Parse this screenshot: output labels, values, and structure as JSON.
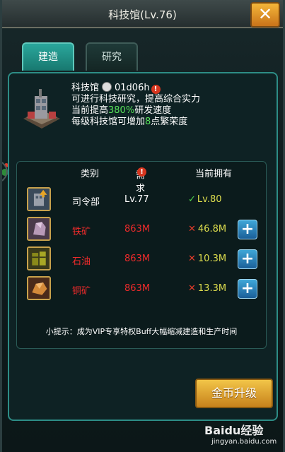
{
  "window": {
    "title": "科技馆(Lv.76)",
    "close_label": "✕"
  },
  "tabs": [
    {
      "label": "建造",
      "active": true
    },
    {
      "label": "研究",
      "active": false
    }
  ],
  "building": {
    "name": "科技馆",
    "timer": "01d06h",
    "line1": "可进行科技研究，提高综合实力",
    "line2_prefix": "当前提高",
    "line2_value": "380%",
    "line2_suffix": "研发速度",
    "line3_prefix": "每级科技馆可增加",
    "line3_value": "8",
    "line3_suffix": "点繁荣度"
  },
  "requirements": {
    "headers": {
      "category": "类别",
      "need": "需求",
      "have": "当前拥有"
    },
    "rows": [
      {
        "category": "司令部",
        "need": "Lv.77",
        "have": "Lv.80",
        "met": true,
        "icon": "hq-icon"
      },
      {
        "category": "铁矿",
        "need": "863M",
        "have": "46.8M",
        "met": false,
        "icon": "iron-ore-icon"
      },
      {
        "category": "石油",
        "need": "863M",
        "have": "10.3M",
        "met": false,
        "icon": "oil-icon"
      },
      {
        "category": "铜矿",
        "need": "863M",
        "have": "13.3M",
        "met": false,
        "icon": "copper-ore-icon"
      }
    ],
    "tip": "小提示：成为VIP专享特权Buff大幅缩减建造和生产时间"
  },
  "upgrade_button": "金币升级",
  "watermark": {
    "brand": "Baidu经验",
    "url": "jingyan.baidu.com"
  },
  "colors": {
    "accent_teal": "#2aa79c",
    "requirement_red": "#ee2b2b",
    "met_yellow": "#dede4e",
    "gold_button": "#e0a534"
  }
}
